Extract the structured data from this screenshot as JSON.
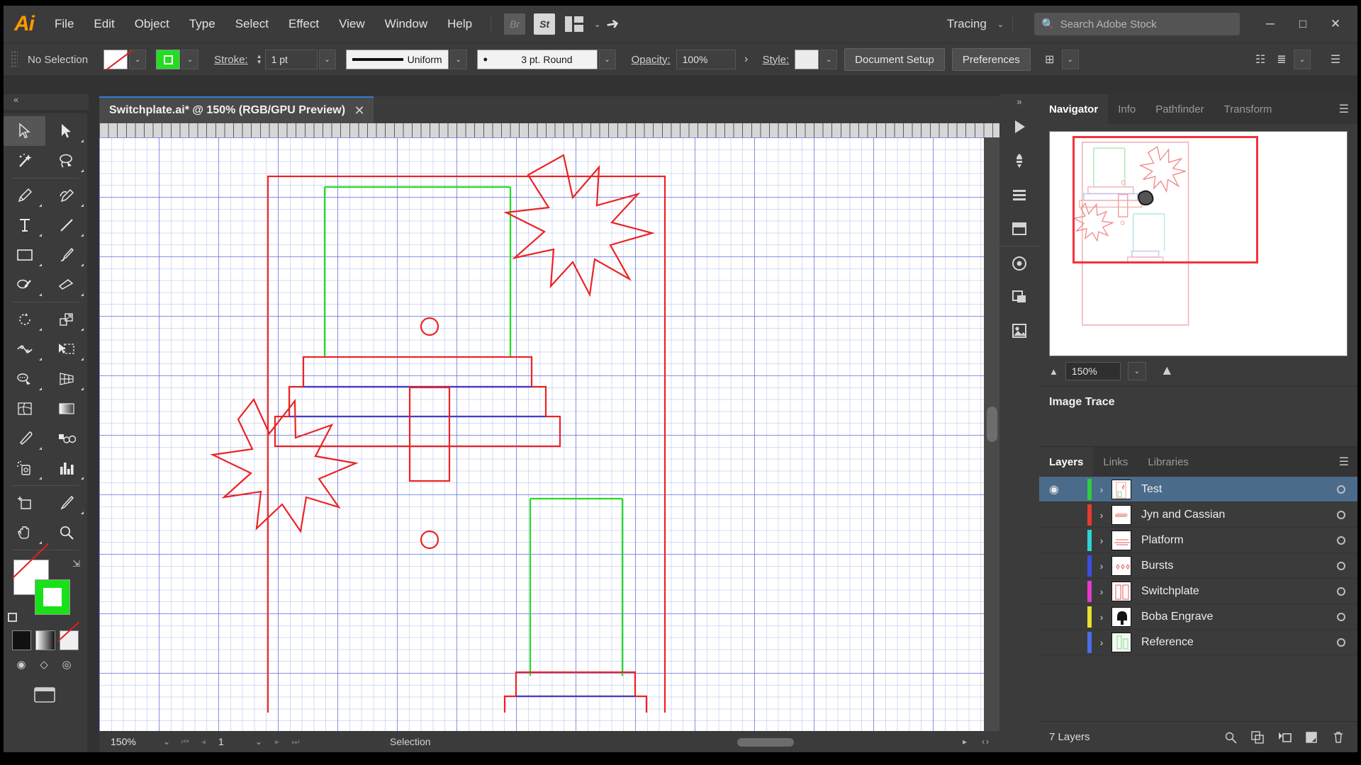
{
  "app": {
    "logo": "Ai"
  },
  "menubar": {
    "items": [
      "File",
      "Edit",
      "Object",
      "Type",
      "Select",
      "Effect",
      "View",
      "Window",
      "Help"
    ],
    "bridge_label": "Br",
    "stock_label": "St",
    "arrange_icon": "arrange-documents-icon",
    "chevron": "⌄",
    "rocket_icon": "discover-icon",
    "workspace": "Tracing",
    "workspace_chevron": "⌄",
    "search_icon": "search-icon",
    "search_placeholder": "Search Adobe Stock",
    "minimize": "─",
    "maximize": "□",
    "close": "✕"
  },
  "controlbar": {
    "selection_status": "No Selection",
    "fill_swatch": "none-fill-swatch",
    "stroke_swatch": "green-stroke-swatch",
    "stroke_label": "Stroke:",
    "stroke_weight": "1 pt",
    "profile_label": "Uniform",
    "brush_label": "3 pt. Round",
    "opacity_label": "Opacity:",
    "opacity_value": "100%",
    "opacity_more": "›",
    "style_label": "Style:",
    "document_setup": "Document Setup",
    "preferences": "Preferences",
    "align_icon": "align-icon",
    "distribute_icon": "distribute-icon",
    "transform_icon": "transform-icon",
    "options_icon": "panel-options-icon",
    "dropdown_chevron": "⌄"
  },
  "toolbar": {
    "collapse": "«",
    "tools": [
      "selection-tool",
      "direct-selection-tool",
      "magic-wand-tool",
      "lasso-tool",
      "pen-tool",
      "curvature-tool",
      "type-tool",
      "line-segment-tool",
      "rectangle-tool",
      "paintbrush-tool",
      "shaper-tool",
      "eraser-tool",
      "rotate-tool",
      "scale-tool",
      "width-tool",
      "free-transform-tool",
      "shape-builder-tool",
      "perspective-grid-tool",
      "mesh-tool",
      "gradient-tool",
      "eyedropper-tool",
      "blend-tool",
      "symbol-sprayer-tool",
      "column-graph-tool",
      "artboard-tool",
      "slice-tool",
      "hand-tool",
      "zoom-tool"
    ],
    "fill_swatch": "fill-none-swatch",
    "stroke_swatch": "stroke-green-swatch",
    "swap_icon": "swap-fill-stroke-icon",
    "default_icon": "default-fill-stroke-icon",
    "color_mode": "color-mode-button",
    "gradient_mode": "gradient-mode-button",
    "none_mode": "none-mode-button",
    "screen_modes": [
      "drawing-mode-normal",
      "drawing-mode-behind",
      "drawing-mode-inside"
    ],
    "change_screen_mode": "change-screen-mode-icon"
  },
  "document": {
    "tab_title": "Switchplate.ai* @ 150% (RGB/GPU Preview)",
    "close_icon": "✕"
  },
  "statusbar": {
    "zoom": "150%",
    "zoom_chevron": "⌄",
    "first_page": "⏮",
    "prev_page": "◂",
    "page": "1",
    "page_chevron": "⌄",
    "next_page": "▸",
    "last_page": "⏭",
    "status_text": "Selection",
    "scroll_left": "▸",
    "scroll_prev": "‹",
    "scroll_next": "›"
  },
  "icondock": {
    "collapse": "»",
    "icons": [
      "libraries-icon",
      "brushes-icon",
      "symbols-icon",
      "artboards-icon",
      "appearance-icon",
      "graphic-styles-icon",
      "image-trace-icon"
    ]
  },
  "navigator": {
    "tabs": [
      {
        "label": "Navigator",
        "active": true
      },
      {
        "label": "Info",
        "active": false
      },
      {
        "label": "Pathfinder",
        "active": false
      },
      {
        "label": "Transform",
        "active": false
      }
    ],
    "menu_icon": "panel-menu-icon",
    "zoom_out_icon": "zoom-out-icon",
    "zoom_in_icon": "zoom-in-icon",
    "zoom_value": "150%",
    "zoom_chevron": "⌄"
  },
  "image_trace": {
    "title": "Image Trace"
  },
  "layers_panel": {
    "tabs": [
      {
        "label": "Layers",
        "active": true
      },
      {
        "label": "Links",
        "active": false
      },
      {
        "label": "Libraries",
        "active": false
      }
    ],
    "menu_icon": "panel-menu-icon",
    "eye_icon": "◉",
    "expand_icon": "›",
    "rows": [
      {
        "name": "Test",
        "color": "#2ecc3f",
        "selected": true,
        "visible": true
      },
      {
        "name": "Jyn and Cassian",
        "color": "#e63b2e",
        "selected": false,
        "visible": false
      },
      {
        "name": "Platform",
        "color": "#2ed4d4",
        "selected": false,
        "visible": false
      },
      {
        "name": "Bursts",
        "color": "#3b4fe0",
        "selected": false,
        "visible": false
      },
      {
        "name": "Switchplate",
        "color": "#e23bd0",
        "selected": false,
        "visible": false
      },
      {
        "name": "Boba Engrave",
        "color": "#e8e030",
        "selected": false,
        "visible": false
      },
      {
        "name": "Reference",
        "color": "#4a6de8",
        "selected": false,
        "visible": false
      }
    ],
    "count_label": "7 Layers",
    "footer_icons": [
      "locate-object-icon",
      "make-mask-icon",
      "release-icon",
      "new-sublayer-icon",
      "new-layer-icon",
      "delete-layer-icon"
    ]
  },
  "artwork": {
    "description": "switchplate-line-art",
    "colors": {
      "red": "#ee2222",
      "green": "#22dd22",
      "blue": "#3344dd"
    }
  }
}
